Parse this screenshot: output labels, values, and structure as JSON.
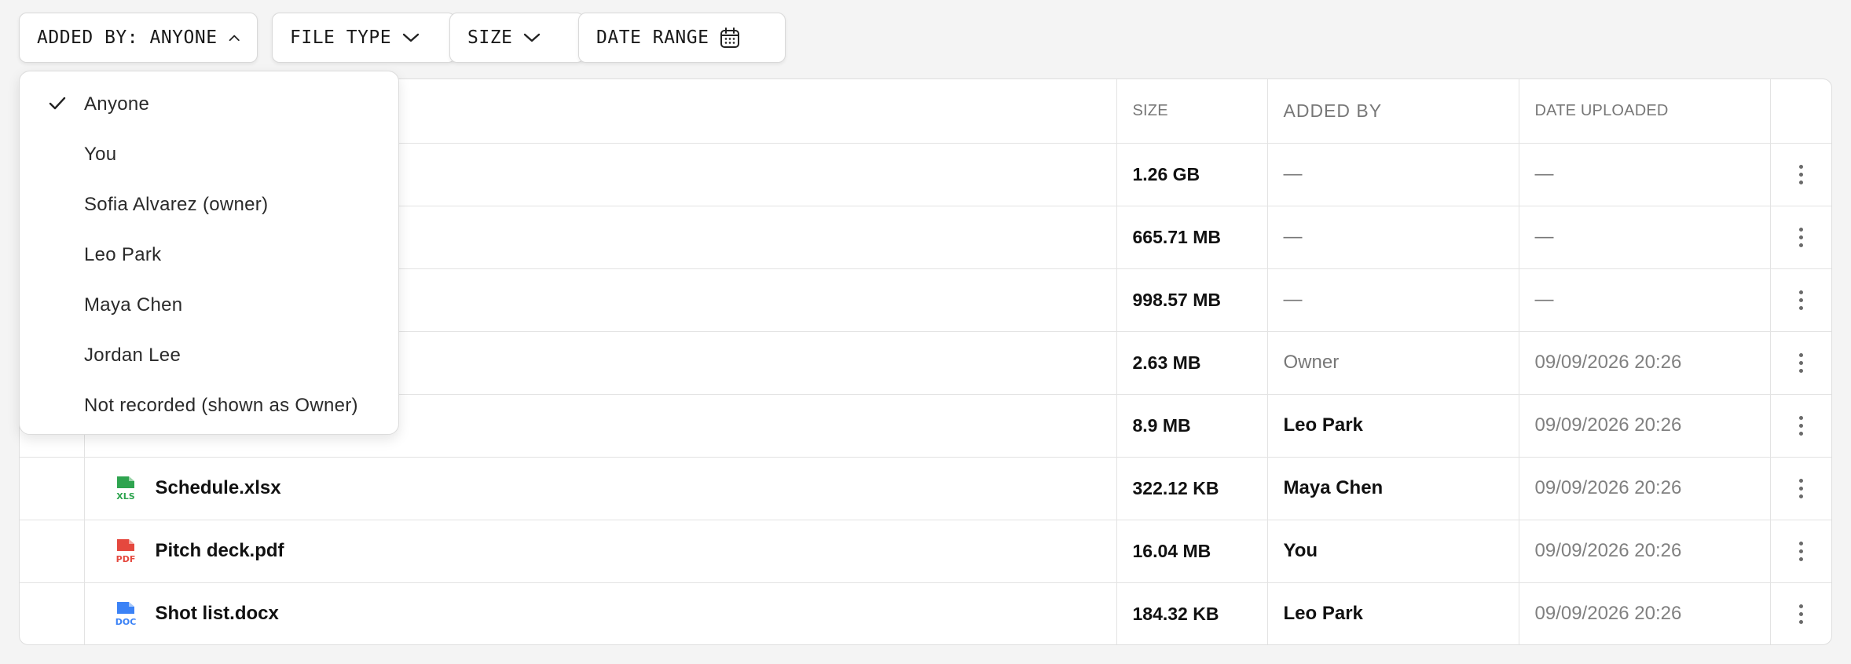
{
  "filters": {
    "added_by": "ADDED BY: ANYONE",
    "file_type": "FILE TYPE",
    "size": "SIZE",
    "date_range": "DATE RANGE"
  },
  "dropdown": {
    "options": [
      {
        "label": "Anyone",
        "selected": true
      },
      {
        "label": "You",
        "selected": false
      },
      {
        "label": "Sofia Alvarez (owner)",
        "selected": false
      },
      {
        "label": "Leo Park",
        "selected": false
      },
      {
        "label": "Maya Chen",
        "selected": false
      },
      {
        "label": "Jordan Lee",
        "selected": false
      },
      {
        "label": "Not recorded (shown as Owner)",
        "selected": false
      }
    ]
  },
  "table": {
    "headers": {
      "size": "SIZE",
      "added_by": "ADDED BY",
      "date_uploaded": "DATE UPLOADED"
    },
    "rows": [
      {
        "name": "",
        "type": "",
        "size": "1.26 GB",
        "added_by": "—",
        "date": "—"
      },
      {
        "name": "",
        "type": "",
        "size": "665.71 MB",
        "added_by": "—",
        "date": "—"
      },
      {
        "name": "",
        "type": "",
        "size": "998.57 MB",
        "added_by": "—",
        "date": "—"
      },
      {
        "name": "",
        "type": "",
        "size": "2.63 MB",
        "added_by": "Owner",
        "date": "09/09/2026 20:26"
      },
      {
        "name": "",
        "type": "",
        "size": "8.9 MB",
        "added_by": "Leo Park",
        "date": "09/09/2026 20:26"
      },
      {
        "name": "Schedule.xlsx",
        "type": "XLS",
        "size": "322.12 KB",
        "added_by": "Maya Chen",
        "date": "09/09/2026 20:26"
      },
      {
        "name": "Pitch deck.pdf",
        "type": "PDF",
        "size": "16.04 MB",
        "added_by": "You",
        "date": "09/09/2026 20:26"
      },
      {
        "name": "Shot list.docx",
        "type": "DOC",
        "size": "184.32 KB",
        "added_by": "Leo Park",
        "date": "09/09/2026 20:26"
      }
    ]
  },
  "icons": {
    "xls": {
      "name": "xls-file-icon",
      "color": "#2ea44f"
    },
    "pdf": {
      "name": "pdf-file-icon",
      "color": "#e5483e"
    },
    "doc": {
      "name": "doc-file-icon",
      "color": "#3b82f6"
    }
  }
}
